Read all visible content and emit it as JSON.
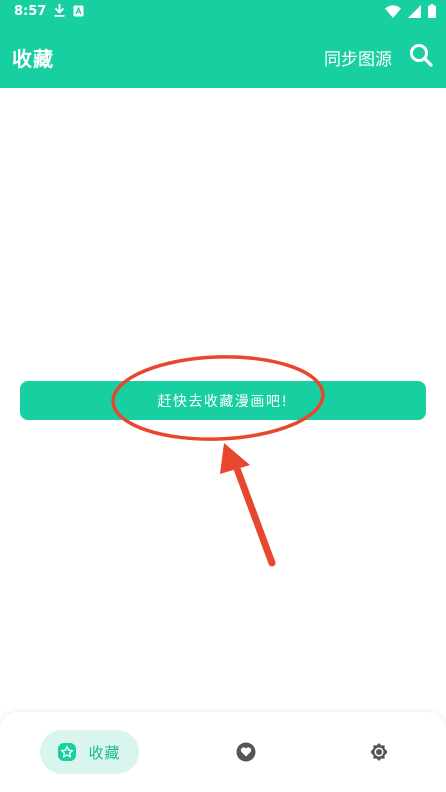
{
  "status_bar": {
    "time": "8:57",
    "left_icons": [
      "download-icon",
      "app-notification-icon"
    ],
    "right_icons": [
      "wifi-icon",
      "signal-icon",
      "battery-icon"
    ]
  },
  "app_bar": {
    "title": "收藏",
    "sync_label": "同步图源",
    "search_icon": "search-icon",
    "background_color": "#17cfa0"
  },
  "main": {
    "cta_label": "赶快去收藏漫画吧!"
  },
  "bottom_nav": {
    "items": [
      {
        "label": "收藏",
        "icon": "favorite-icon",
        "active": true
      },
      {
        "label": "",
        "icon": "heart-icon",
        "active": false
      },
      {
        "label": "",
        "icon": "settings-icon",
        "active": false
      }
    ]
  },
  "colors": {
    "accent": "#17cfa0",
    "annotation": "#e8472f",
    "nav_active_bg": "#d9f6ee"
  }
}
